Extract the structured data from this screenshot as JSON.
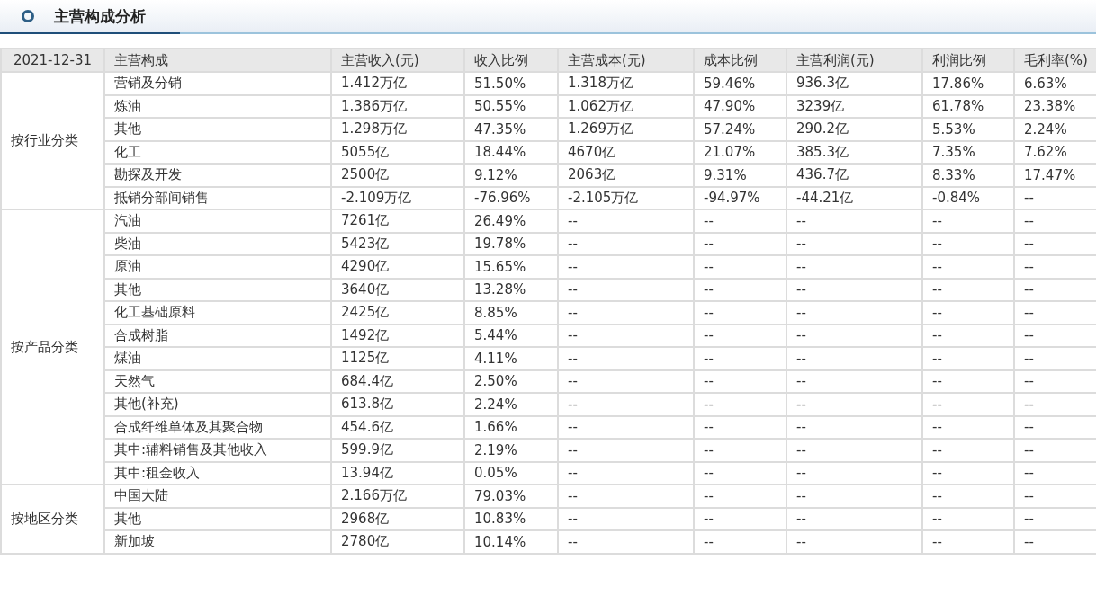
{
  "title": "主营构成分析",
  "table": {
    "columns": [
      "2021-12-31",
      "主营构成",
      "主营收入(元)",
      "收入比例",
      "主营成本(元)",
      "成本比例",
      "主营利润(元)",
      "利润比例",
      "毛利率(%)"
    ],
    "groups": [
      {
        "label": "按行业分类",
        "rows": [
          [
            "营销及分销",
            "1.412万亿",
            "51.50%",
            "1.318万亿",
            "59.46%",
            "936.3亿",
            "17.86%",
            "6.63%"
          ],
          [
            "炼油",
            "1.386万亿",
            "50.55%",
            "1.062万亿",
            "47.90%",
            "3239亿",
            "61.78%",
            "23.38%"
          ],
          [
            "其他",
            "1.298万亿",
            "47.35%",
            "1.269万亿",
            "57.24%",
            "290.2亿",
            "5.53%",
            "2.24%"
          ],
          [
            "化工",
            "5055亿",
            "18.44%",
            "4670亿",
            "21.07%",
            "385.3亿",
            "7.35%",
            "7.62%"
          ],
          [
            "勘探及开发",
            "2500亿",
            "9.12%",
            "2063亿",
            "9.31%",
            "436.7亿",
            "8.33%",
            "17.47%"
          ],
          [
            "抵销分部间销售",
            "-2.109万亿",
            "-76.96%",
            "-2.105万亿",
            "-94.97%",
            "-44.21亿",
            "-0.84%",
            "--"
          ]
        ]
      },
      {
        "label": "按产品分类",
        "rows": [
          [
            "汽油",
            "7261亿",
            "26.49%",
            "--",
            "--",
            "--",
            "--",
            "--"
          ],
          [
            "柴油",
            "5423亿",
            "19.78%",
            "--",
            "--",
            "--",
            "--",
            "--"
          ],
          [
            "原油",
            "4290亿",
            "15.65%",
            "--",
            "--",
            "--",
            "--",
            "--"
          ],
          [
            "其他",
            "3640亿",
            "13.28%",
            "--",
            "--",
            "--",
            "--",
            "--"
          ],
          [
            "化工基础原料",
            "2425亿",
            "8.85%",
            "--",
            "--",
            "--",
            "--",
            "--"
          ],
          [
            "合成树脂",
            "1492亿",
            "5.44%",
            "--",
            "--",
            "--",
            "--",
            "--"
          ],
          [
            "煤油",
            "1125亿",
            "4.11%",
            "--",
            "--",
            "--",
            "--",
            "--"
          ],
          [
            "天然气",
            "684.4亿",
            "2.50%",
            "--",
            "--",
            "--",
            "--",
            "--"
          ],
          [
            "其他(补充)",
            "613.8亿",
            "2.24%",
            "--",
            "--",
            "--",
            "--",
            "--"
          ],
          [
            "合成纤维单体及其聚合物",
            "454.6亿",
            "1.66%",
            "--",
            "--",
            "--",
            "--",
            "--"
          ],
          [
            "其中:辅料销售及其他收入",
            "599.9亿",
            "2.19%",
            "--",
            "--",
            "--",
            "--",
            "--"
          ],
          [
            "其中:租金收入",
            "13.94亿",
            "0.05%",
            "--",
            "--",
            "--",
            "--",
            "--"
          ]
        ]
      },
      {
        "label": "按地区分类",
        "rows": [
          [
            "中国大陆",
            "2.166万亿",
            "79.03%",
            "--",
            "--",
            "--",
            "--",
            "--"
          ],
          [
            "其他",
            "2968亿",
            "10.83%",
            "--",
            "--",
            "--",
            "--",
            "--"
          ],
          [
            "新加坡",
            "2780亿",
            "10.14%",
            "--",
            "--",
            "--",
            "--",
            "--"
          ]
        ]
      }
    ]
  }
}
